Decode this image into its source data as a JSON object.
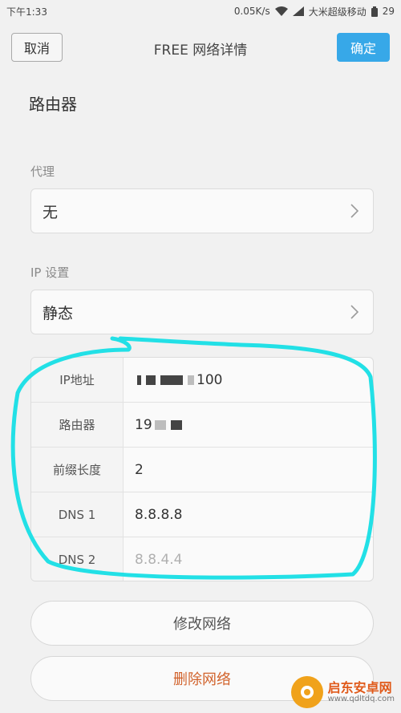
{
  "status_bar": {
    "time": "下午1:33",
    "speed": "0.05K/s",
    "carrier": "大米超级移动",
    "battery": "29"
  },
  "header": {
    "cancel_label": "取消",
    "title": "FREE  网络详情",
    "confirm_label": "确定"
  },
  "router_label": "路由器",
  "proxy": {
    "section_label": "代理",
    "value": "无"
  },
  "ip_settings": {
    "section_label": "IP 设置",
    "value": "静态"
  },
  "ip_table": {
    "rows": [
      {
        "key": "IP地址",
        "value": "100"
      },
      {
        "key": "路由器",
        "value": "19"
      },
      {
        "key": "前缀长度",
        "value": "2"
      },
      {
        "key": "DNS 1",
        "value": "8.8.8.8"
      },
      {
        "key": "DNS 2",
        "value": "8.8.4.4"
      }
    ]
  },
  "actions": {
    "modify_label": "修改网络",
    "delete_label": "删除网络"
  },
  "watermark": {
    "title": "启东安卓网",
    "url": "www.qdltdq.com"
  },
  "colors": {
    "accent": "#37a8e8",
    "delete": "#d1622b",
    "annotation": "#22e0e6"
  }
}
